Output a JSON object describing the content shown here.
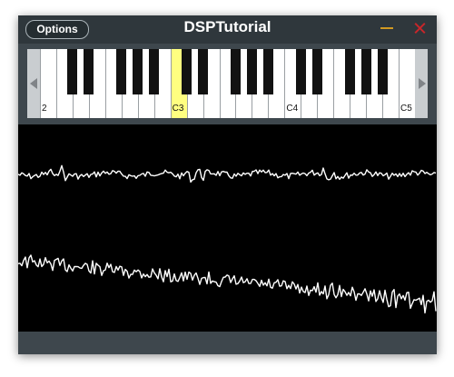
{
  "window": {
    "title": "DSPTutorial"
  },
  "toolbar": {
    "options_label": "Options"
  },
  "keyboard": {
    "first_white_note": "B2",
    "white_key_count": 23,
    "highlighted_white_index": 8,
    "labels": [
      {
        "white_index": 0,
        "text": "2"
      },
      {
        "white_index": 8,
        "text": "C3"
      },
      {
        "white_index": 15,
        "text": "C4"
      },
      {
        "white_index": 22,
        "text": "C5"
      }
    ]
  },
  "colors": {
    "background": "#3e474d",
    "titlebar": "#2f373c",
    "minimize": "#d29a22",
    "close": "#c8262a",
    "key_highlight": "#ffff80",
    "wave": "#ffffff",
    "scope": "#000000"
  },
  "icons": {
    "minimize": "minimize-icon",
    "close": "close-icon",
    "scroll_left": "triangle-left-icon",
    "scroll_right": "triangle-right-icon"
  }
}
